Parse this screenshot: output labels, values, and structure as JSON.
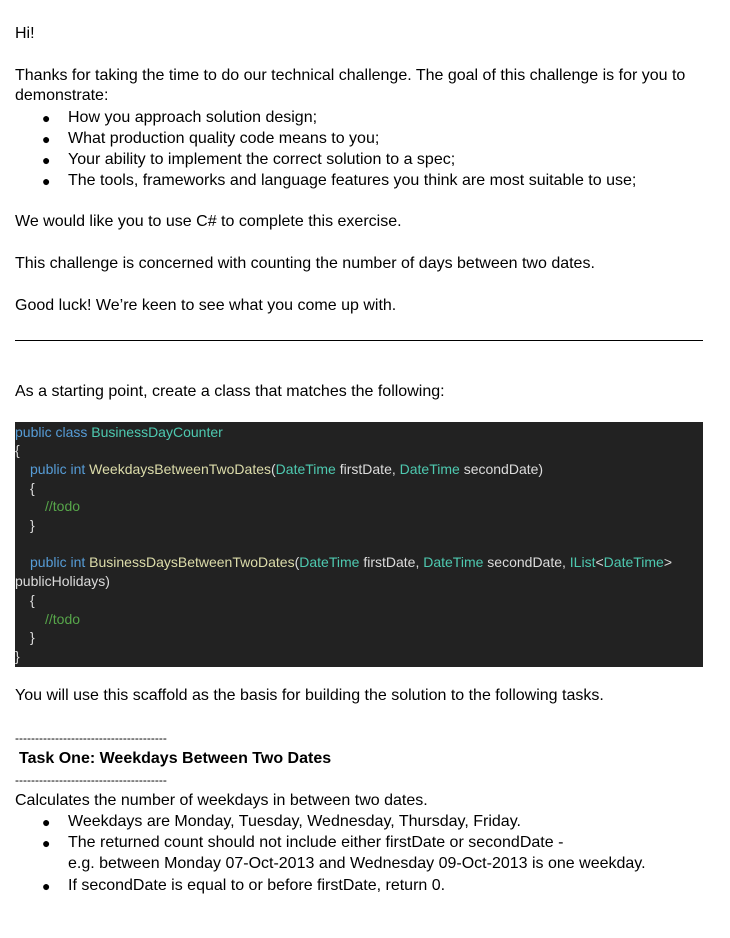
{
  "doc": {
    "greeting": "Hi!",
    "intro": "Thanks for taking the time to do our technical challenge. The goal of this challenge is for you to",
    "intro2": "demonstrate:",
    "goals": [
      "How you approach solution design;",
      "What production quality code means to you;",
      "Your ability to implement the correct solution to a spec;",
      "The tools, frameworks and language features you think are most suitable to use;"
    ],
    "language_note": "We would like you to use C# to complete this exercise.",
    "concern": "This challenge is concerned with counting the number of days between two dates.",
    "good_luck": "Good luck! We’re keen to see what you come up with.",
    "starting_point": "As a starting point, create a class that matches the following:",
    "scaffold_note": "You will use this scaffold as the basis for building the solution to the following tasks.",
    "divider": "--------------------------------------",
    "task_one": {
      "heading": "Task One: Weekdays Between Two Dates",
      "summary": "Calculates the number of weekdays in between two dates.",
      "bullets": [
        "Weekdays are Monday, Tuesday, Wednesday, Thursday, Friday.",
        "The returned count should not include either firstDate or secondDate -",
        "If secondDate is equal to or before firstDate, return 0."
      ],
      "example": "e.g. between Monday 07-Oct-2013 and Wednesday 09-Oct-2013 is one weekday."
    }
  },
  "code": {
    "l1_kw": "public class ",
    "l1_name": "BusinessDayCounter",
    "open": "{",
    "close": "}",
    "m1_kw": "public int ",
    "m1_name": "WeekdaysBetweenTwoDates",
    "paren_open": "(",
    "type_dt": "DateTime",
    "p_first": " firstDate, ",
    "p_second": " secondDate)",
    "todo": "//todo",
    "m2_kw": "public int ",
    "m2_name": "BusinessDaysBetweenTwoDates",
    "p_second2": " secondDate, ",
    "type_ilist": "IList",
    "lt": "<",
    "gt": ">",
    "l_holidays": "publicHolidays)"
  },
  "colors": {
    "code_bg": "#222222",
    "keyword": "#569cd6",
    "type": "#4ec9b0",
    "method": "#dcdcaa",
    "comment": "#57a64a"
  }
}
